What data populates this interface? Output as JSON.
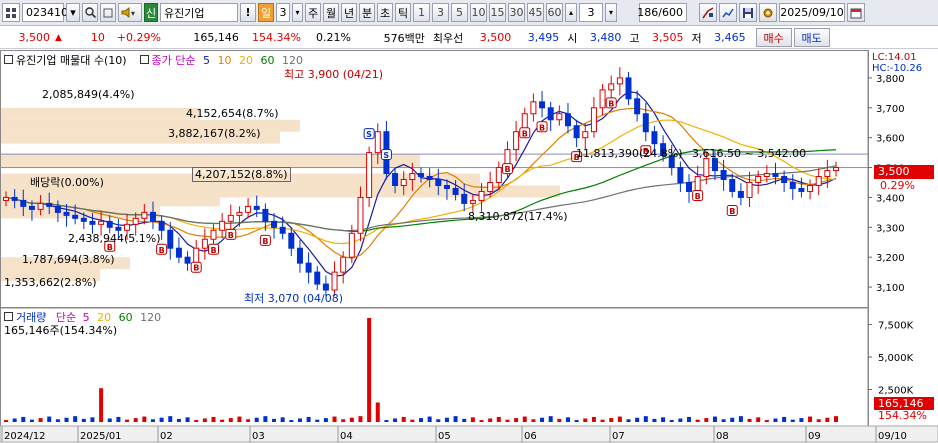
{
  "toolbar": {
    "code": "023410",
    "badge": "신",
    "stock_name": "유진기업",
    "alert": "!",
    "period_day": "일",
    "period_num": "3",
    "periods": [
      "주",
      "월",
      "년",
      "분",
      "초",
      "틱"
    ],
    "intervals": [
      "1",
      "3",
      "5",
      "10",
      "15",
      "30",
      "45",
      "60"
    ],
    "interval_value": "3",
    "count": "186/600",
    "date": "2025/09/10"
  },
  "quote": {
    "price": "3,500",
    "change": "10",
    "change_pct": "+0.29%",
    "volume": "165,146",
    "volume_ratio": "154.34%",
    "turnover": "0.21%",
    "amount": "576백만",
    "best_label": "최우선",
    "best_ask": "3,500",
    "best_bid": "3,495",
    "open_label": "시",
    "open": "3,480",
    "high_label": "고",
    "high": "3,505",
    "low_label": "저",
    "low": "3,465",
    "buy_label": "매수",
    "sell_label": "매도"
  },
  "price_panel": {
    "legend_title": "유진기업 매물대 수(10)",
    "legend_ma": "종가 단순",
    "ma_periods": [
      "5",
      "10",
      "20",
      "60",
      "120"
    ],
    "lc": "LC:14.01",
    "hc": "HC:-10.26",
    "dividend": "배당락(0.00%)",
    "high_note": "최고 3,900 (04/21)",
    "low_note": "최저 3,070 (04/08)",
    "current_price": "3,500",
    "current_pct": "0.29%",
    "profile_labels": [
      "2,085,849(4.4%)",
      "4,152,654(8.7%)",
      "3,882,167(8.2%)",
      "4,207,152(8.8%)",
      "1,787,694(3.8%)",
      "1,353,662(2.8%)",
      "2,438,944(5.1%)",
      "8,310,872(17.4%)",
      "11,813,390(24.8%)",
      "3,616.50 ~ 3,542.00"
    ]
  },
  "volume_panel": {
    "legend_title": "거래량",
    "legend_ma": "단순",
    "ma_periods": [
      "5",
      "20",
      "60",
      "120"
    ],
    "summary": "165,146주(154.34%)",
    "current": "165,146",
    "current_pct": "154.34%"
  },
  "x_axis": [
    "2024/12",
    "2025/01",
    "02",
    "03",
    "04",
    "05",
    "06",
    "07",
    "08",
    "09",
    "09/10"
  ],
  "colors": {
    "up": "#e00000",
    "down": "#0030d0",
    "ma5": "#1a1aa0",
    "ma10": "#e08000",
    "ma20": "#f0b000",
    "ma60": "#008000",
    "ma120": "#707070",
    "profile": "#f6e2c8"
  },
  "chart_data": {
    "type": "candlestick",
    "price_axis": {
      "min": 3050,
      "max": 3860,
      "ticks": [
        3100,
        3200,
        3300,
        3400,
        3500,
        3600,
        3700,
        3800
      ]
    },
    "volume_axis": {
      "min": 0,
      "max": 8000000,
      "ticks": [
        2500000,
        5000000,
        7500000
      ],
      "tick_labels": [
        "2,500K",
        "5,000K",
        "7,500K"
      ]
    },
    "extremes": {
      "high": 3900,
      "high_date": "04/21",
      "low": 3070,
      "low_date": "04/08"
    },
    "close_series_approx": [
      3400,
      3390,
      3370,
      3360,
      3380,
      3370,
      3350,
      3340,
      3330,
      3320,
      3310,
      3320,
      3300,
      3290,
      3310,
      3330,
      3350,
      3320,
      3290,
      3230,
      3200,
      3180,
      3230,
      3260,
      3290,
      3320,
      3340,
      3350,
      3370,
      3360,
      3320,
      3300,
      3280,
      3230,
      3180,
      3150,
      3110,
      3090,
      3150,
      3200,
      3280,
      3400,
      3550,
      3620,
      3480,
      3440,
      3460,
      3480,
      3470,
      3460,
      3440,
      3430,
      3410,
      3380,
      3390,
      3420,
      3450,
      3500,
      3560,
      3620,
      3680,
      3720,
      3700,
      3660,
      3680,
      3640,
      3600,
      3620,
      3700,
      3760,
      3780,
      3800,
      3730,
      3680,
      3620,
      3580,
      3540,
      3500,
      3450,
      3420,
      3470,
      3530,
      3490,
      3460,
      3420,
      3400,
      3450,
      3470,
      3480,
      3470,
      3450,
      3430,
      3420,
      3440,
      3470,
      3490,
      3500
    ]
  }
}
